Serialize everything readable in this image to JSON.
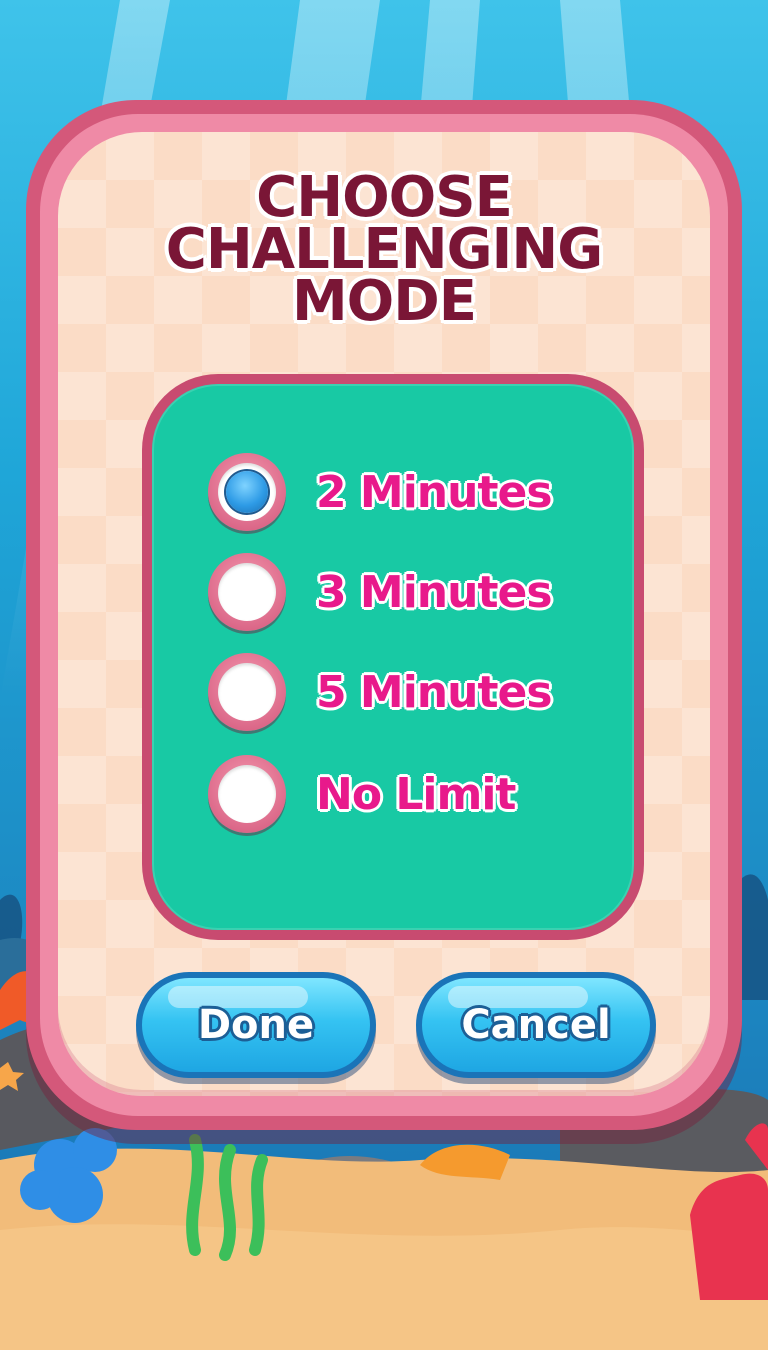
{
  "title": {
    "line1": "CHOOSE",
    "line2": "CHALLENGING",
    "line3": "MODE"
  },
  "options": [
    {
      "label": "2 Minutes",
      "selected": true
    },
    {
      "label": "3 Minutes",
      "selected": false
    },
    {
      "label": "5 Minutes",
      "selected": false
    },
    {
      "label": "No Limit",
      "selected": false
    }
  ],
  "buttons": {
    "done": "Done",
    "cancel": "Cancel"
  },
  "colors": {
    "water_top": "#1fa6d8",
    "water_bottom": "#1a6fb0",
    "sand": "#f2bc7a",
    "panel_border": "#d4587a",
    "panel_face": "#fbdcc6",
    "card_face": "#18c9a4",
    "title": "#7a1636",
    "option_text": "#e8198b",
    "button_face": "#35c3f2"
  }
}
